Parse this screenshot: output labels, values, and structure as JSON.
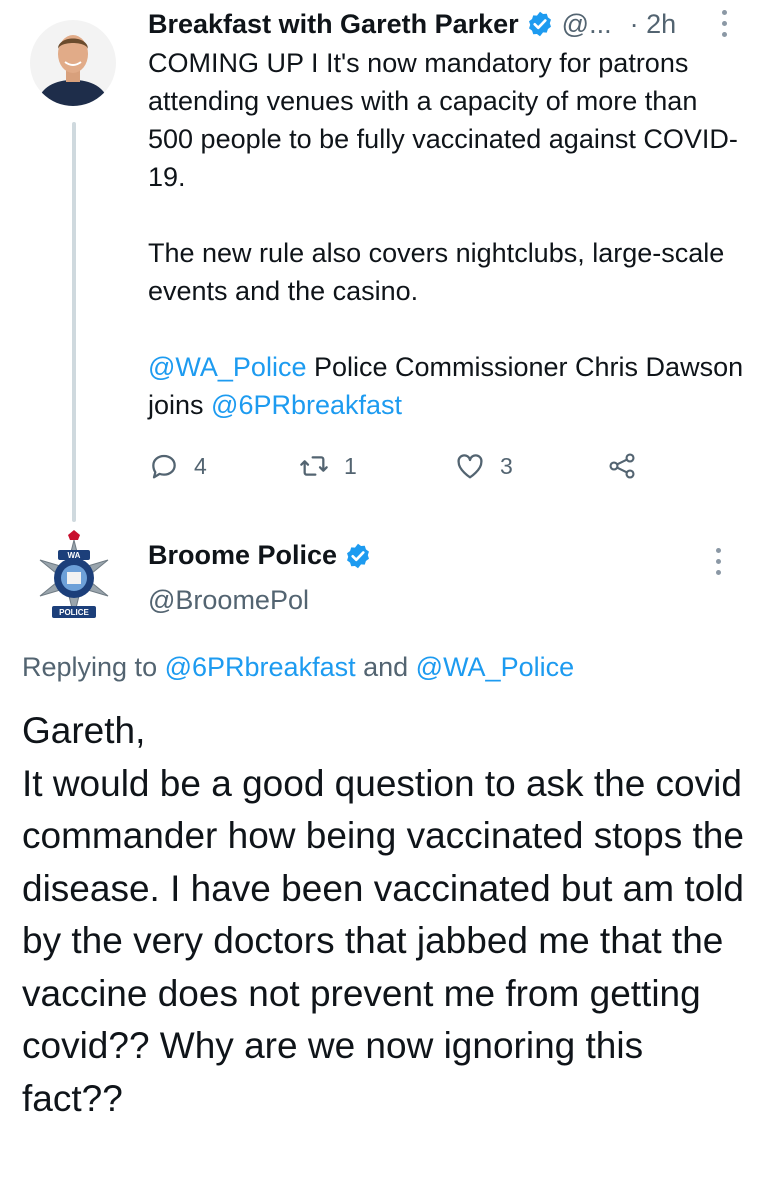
{
  "tweet1": {
    "author_name": "Breakfast with Gareth Parker",
    "handle": "@...",
    "time": "· 2h",
    "text_intro": "COMING UP I It's now mandatory for patrons attending venues with a capacity of more than 500 people to be fully vaccinated against COVID-19.\n\nThe new rule also covers nightclubs, large-scale events and the casino.\n\n",
    "mention1": "@WA_Police",
    "text_mid": " Police Commissioner Chris Dawson joins ",
    "mention2": "@6PRbreakfast",
    "replies": "4",
    "retweets": "1",
    "likes": "3"
  },
  "tweet2": {
    "author_name": "Broome Police",
    "handle": "@BroomePol",
    "replying_prefix": "Replying to ",
    "replying_mention1": "@6PRbreakfast",
    "replying_and": " and ",
    "replying_mention2": "@WA_Police",
    "text": "Gareth,\nIt would be a good question to ask the covid commander how being vaccinated stops the disease. I have been vaccinated but am told by the very doctors that jabbed me that the vaccine does not prevent me from getting covid?? Why are we now ignoring this fact??",
    "logo_text_top": "WA",
    "logo_text_bottom": "POLICE"
  },
  "colors": {
    "link": "#1d9bf0",
    "secondary_text": "#536471",
    "thread_line": "#cfd9de"
  },
  "icons": [
    "reply-icon",
    "retweet-icon",
    "like-icon",
    "share-icon",
    "verified-badge-icon",
    "more-options-icon"
  ]
}
